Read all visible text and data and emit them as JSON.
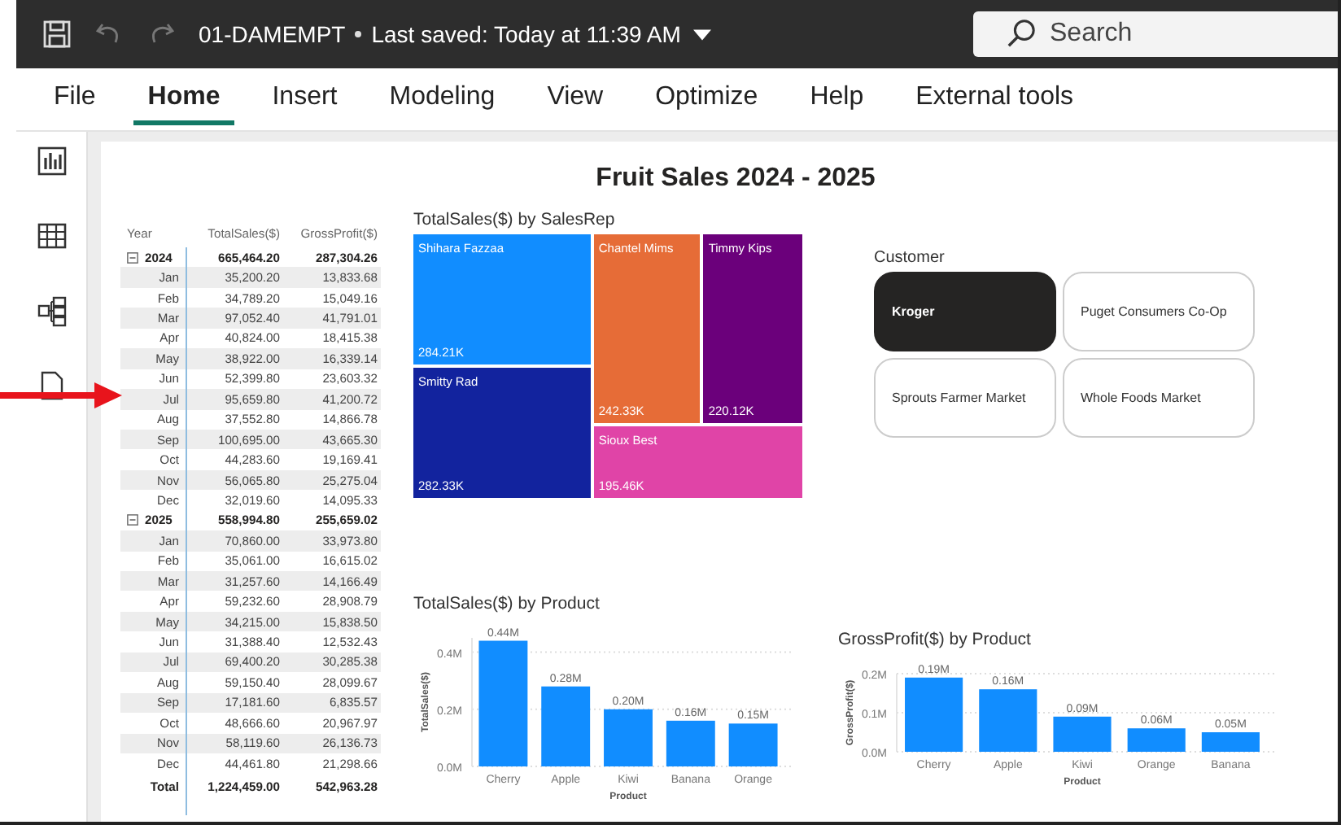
{
  "title_bar": {
    "file_name": "01-DAMEMPT",
    "saved_status": "Last saved: Today at 11:39 AM",
    "search": {
      "placeholder": "Search"
    }
  },
  "ribbon_tabs": [
    {
      "label": "File",
      "selected": false
    },
    {
      "label": "Home",
      "selected": true
    },
    {
      "label": "Insert",
      "selected": false
    },
    {
      "label": "Modeling",
      "selected": false
    },
    {
      "label": "View",
      "selected": false
    },
    {
      "label": "Optimize",
      "selected": false
    },
    {
      "label": "Help",
      "selected": false
    },
    {
      "label": "External tools",
      "selected": false
    }
  ],
  "report": {
    "title": "Fruit Sales 2024 - 2025",
    "matrix": {
      "columns": [
        "Year",
        "TotalSales($)",
        "GrossProfit($)"
      ],
      "groups": [
        {
          "label": "2024",
          "expanded": true,
          "total_sales": "665,464.20",
          "gross_profit": "287,304.26",
          "rows": [
            {
              "month": "Jan",
              "sales": "35,200.20",
              "profit": "13,833.68"
            },
            {
              "month": "Feb",
              "sales": "34,789.20",
              "profit": "15,049.16"
            },
            {
              "month": "Mar",
              "sales": "97,052.40",
              "profit": "41,791.01"
            },
            {
              "month": "Apr",
              "sales": "40,824.00",
              "profit": "18,415.38"
            },
            {
              "month": "May",
              "sales": "38,922.00",
              "profit": "16,339.14"
            },
            {
              "month": "Jun",
              "sales": "52,399.80",
              "profit": "23,603.32"
            },
            {
              "month": "Jul",
              "sales": "95,659.80",
              "profit": "41,200.72"
            },
            {
              "month": "Aug",
              "sales": "37,552.80",
              "profit": "14,866.78"
            },
            {
              "month": "Sep",
              "sales": "100,695.00",
              "profit": "43,665.30"
            },
            {
              "month": "Oct",
              "sales": "44,283.60",
              "profit": "19,169.41"
            },
            {
              "month": "Nov",
              "sales": "56,065.80",
              "profit": "25,275.04"
            },
            {
              "month": "Dec",
              "sales": "32,019.60",
              "profit": "14,095.33"
            }
          ]
        },
        {
          "label": "2025",
          "expanded": true,
          "total_sales": "558,994.80",
          "gross_profit": "255,659.02",
          "rows": [
            {
              "month": "Jan",
              "sales": "70,860.00",
              "profit": "33,973.80"
            },
            {
              "month": "Feb",
              "sales": "35,061.00",
              "profit": "16,615.02"
            },
            {
              "month": "Mar",
              "sales": "31,257.60",
              "profit": "14,166.49"
            },
            {
              "month": "Apr",
              "sales": "59,232.60",
              "profit": "28,908.79"
            },
            {
              "month": "May",
              "sales": "34,215.00",
              "profit": "15,838.50"
            },
            {
              "month": "Jun",
              "sales": "31,388.40",
              "profit": "12,532.43"
            },
            {
              "month": "Jul",
              "sales": "69,400.20",
              "profit": "30,285.38"
            },
            {
              "month": "Aug",
              "sales": "59,150.40",
              "profit": "28,099.67"
            },
            {
              "month": "Sep",
              "sales": "17,181.60",
              "profit": "6,835.57"
            },
            {
              "month": "Oct",
              "sales": "48,666.60",
              "profit": "20,967.97"
            },
            {
              "month": "Nov",
              "sales": "58,119.60",
              "profit": "26,136.73"
            },
            {
              "month": "Dec",
              "sales": "44,461.80",
              "profit": "21,298.66"
            }
          ]
        }
      ],
      "total": {
        "label": "Total",
        "total_sales": "1,224,459.00",
        "gross_profit": "542,963.28"
      }
    },
    "treemap": {
      "title": "TotalSales($) by SalesRep",
      "tiles": [
        {
          "name": "Shihara Fazzaa",
          "value": "284.21K",
          "color": "#118dff"
        },
        {
          "name": "Smitty Rad",
          "value": "282.33K",
          "color": "#12239e"
        },
        {
          "name": "Chantel Mims",
          "value": "242.33K",
          "color": "#e66c37"
        },
        {
          "name": "Timmy Kips",
          "value": "220.12K",
          "color": "#6b007b"
        },
        {
          "name": "Sioux Best",
          "value": "195.46K",
          "color": "#e044a7"
        }
      ]
    },
    "slicer": {
      "title": "Customer",
      "options": [
        {
          "label": "Kroger",
          "selected": true
        },
        {
          "label": "Puget Consumers Co-Op",
          "selected": false
        },
        {
          "label": "Sprouts Farmer Market",
          "selected": false
        },
        {
          "label": "Whole Foods Market",
          "selected": false
        }
      ]
    },
    "charts": [
      {
        "chart_data": {
          "type": "bar",
          "title": "TotalSales($) by Product",
          "xlabel": "Product",
          "ylabel": "TotalSales($)",
          "categories": [
            "Cherry",
            "Apple",
            "Kiwi",
            "Banana",
            "Orange"
          ],
          "series": [
            {
              "color": "#118dff",
              "values": [
                0.44,
                0.28,
                0.2,
                0.16,
                0.15
              ]
            }
          ],
          "ylim": [
            0,
            0.45
          ],
          "yticks": [
            {
              "value": 0,
              "label": "0.0M"
            },
            {
              "value": 0.2,
              "label": "0.2M"
            },
            {
              "value": 0.4,
              "label": "0.4M"
            }
          ],
          "value_labels": [
            "0.44M",
            "0.28M",
            "0.20M",
            "0.16M",
            "0.15M"
          ]
        }
      },
      {
        "chart_data": {
          "type": "bar",
          "title": "GrossProfit($) by Product",
          "xlabel": "Product",
          "ylabel": "GrossProfit($)",
          "categories": [
            "Cherry",
            "Apple",
            "Kiwi",
            "Orange",
            "Banana"
          ],
          "series": [
            {
              "color": "#118dff",
              "values": [
                0.19,
                0.16,
                0.09,
                0.06,
                0.05
              ]
            }
          ],
          "ylim": [
            0,
            0.2
          ],
          "yticks": [
            {
              "value": 0,
              "label": "0.0M"
            },
            {
              "value": 0.1,
              "label": "0.1M"
            },
            {
              "value": 0.2,
              "label": "0.2M"
            }
          ],
          "value_labels": [
            "0.19M",
            "0.16M",
            "0.09M",
            "0.06M",
            "0.05M"
          ]
        }
      }
    ]
  }
}
